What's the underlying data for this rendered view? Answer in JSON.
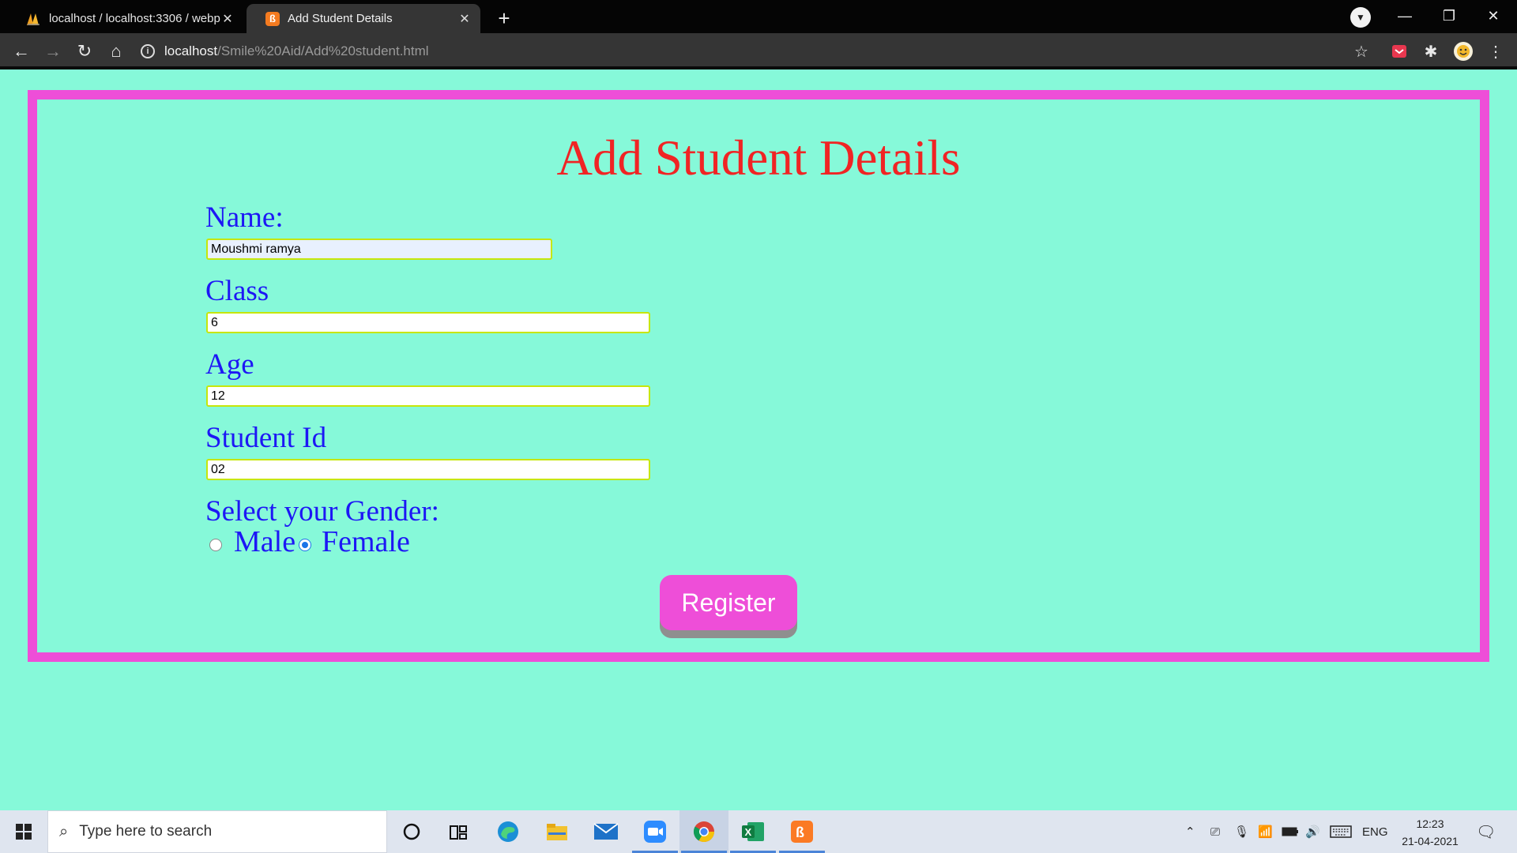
{
  "browser": {
    "tabs": [
      {
        "title": "localhost / localhost:3306 / webp",
        "active": false
      },
      {
        "title": "Add Student Details",
        "active": true
      }
    ],
    "url_host": "localhost",
    "url_path": "/Smile%20Aid/Add%20student.html"
  },
  "page": {
    "heading": "Add Student Details",
    "fields": [
      {
        "label": "Name:",
        "value": "Moushmi ramya"
      },
      {
        "label": "Class",
        "value": "6"
      },
      {
        "label": "Age",
        "value": "12"
      },
      {
        "label": "Student Id",
        "value": "02"
      }
    ],
    "gender": {
      "label": "Select your Gender:",
      "options": [
        {
          "label": "Male",
          "checked": false
        },
        {
          "label": "Female",
          "checked": true
        }
      ]
    },
    "register_label": "Register",
    "colors": {
      "background": "#86f9d9",
      "border": "#ee4ed8",
      "heading": "#f02424",
      "labels": "#1d17f5",
      "button": "#ee4ed8"
    }
  },
  "taskbar": {
    "search_placeholder": "Type here to search",
    "apps": [
      "cortana-icon",
      "task-view-icon",
      "edge-icon",
      "file-explorer-icon",
      "mail-icon",
      "zoom-icon",
      "chrome-icon",
      "excel-icon",
      "xampp-icon"
    ],
    "language": "ENG",
    "time": "12:23",
    "date": "21-04-2021"
  }
}
